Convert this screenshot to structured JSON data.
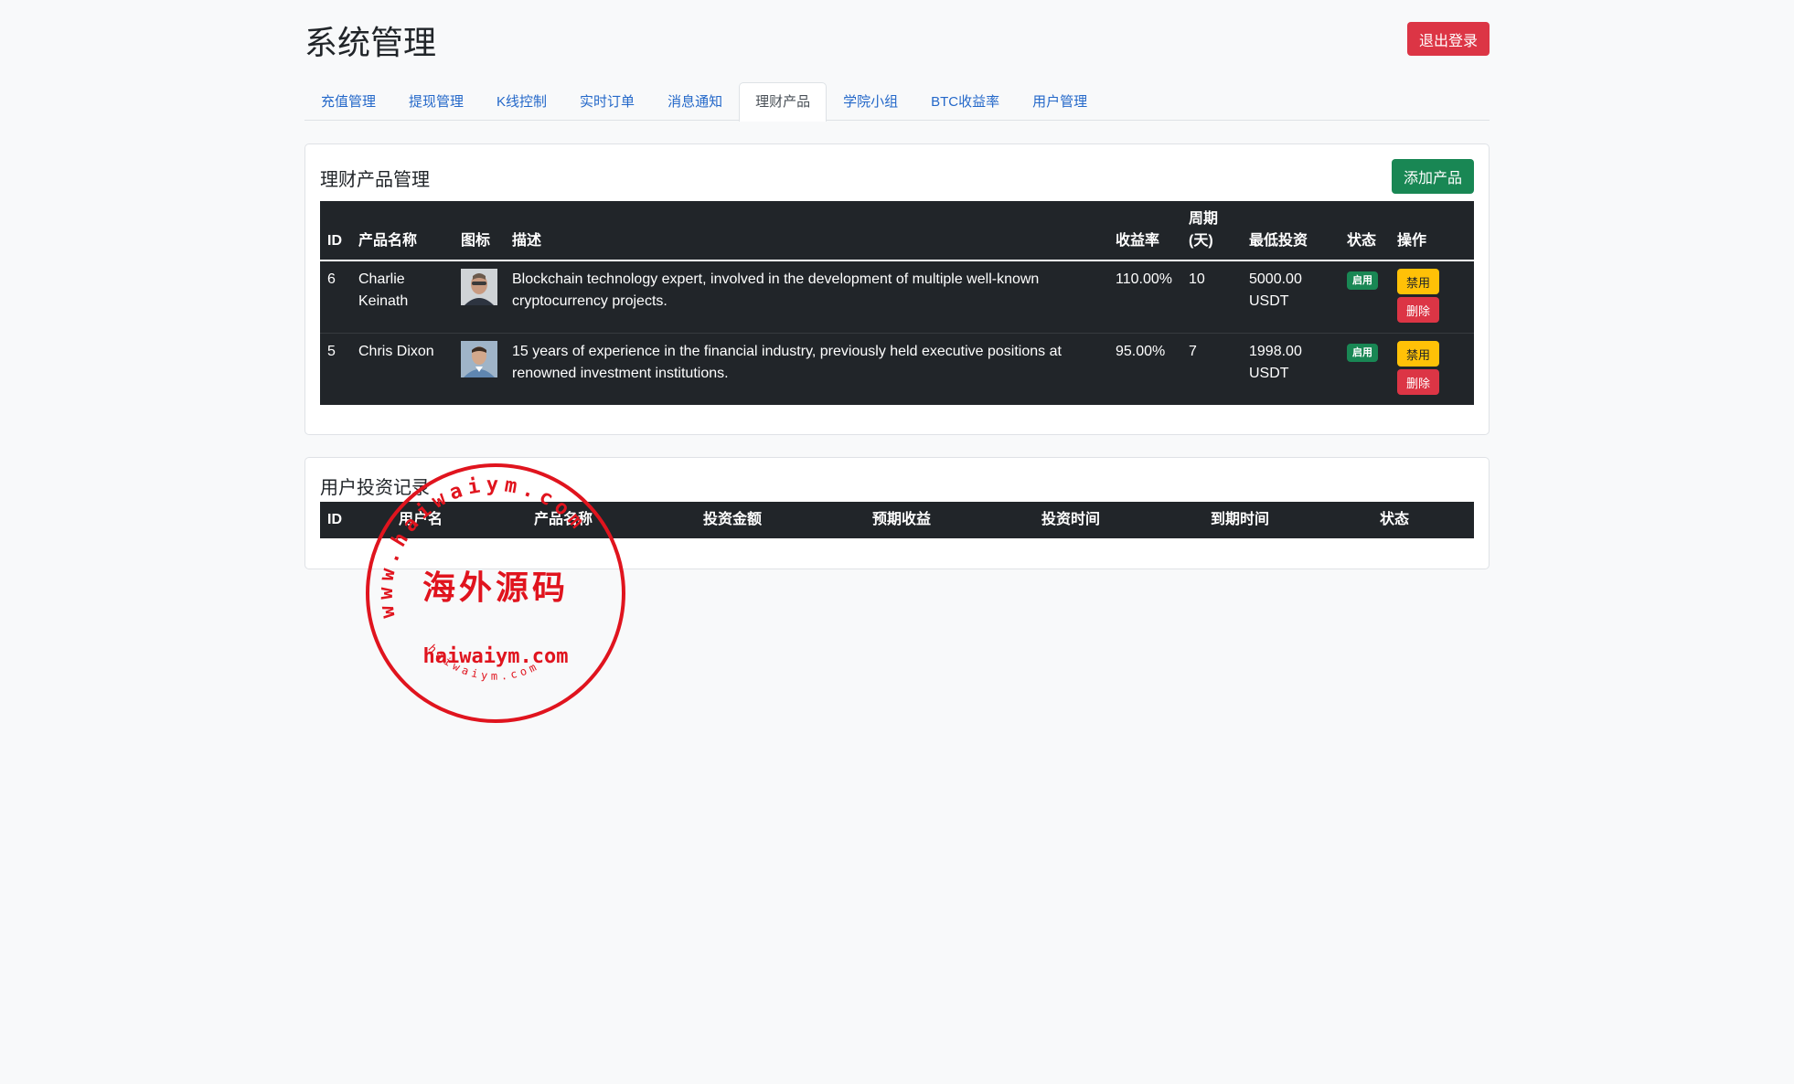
{
  "header": {
    "title": "系统管理",
    "logout_label": "退出登录"
  },
  "tabs": [
    {
      "label": "充值管理"
    },
    {
      "label": "提现管理"
    },
    {
      "label": "K线控制"
    },
    {
      "label": "实时订单"
    },
    {
      "label": "消息通知"
    },
    {
      "label": "理财产品"
    },
    {
      "label": "学院小组"
    },
    {
      "label": "BTC收益率"
    },
    {
      "label": "用户管理"
    }
  ],
  "products_card": {
    "title": "理财产品管理",
    "add_label": "添加产品",
    "columns": [
      "ID",
      "产品名称",
      "图标",
      "描述",
      "收益率",
      "周期(天)",
      "最低投资",
      "状态",
      "操作"
    ],
    "rows": [
      {
        "id": "6",
        "name": "Charlie Keinath",
        "description": "Blockchain technology expert, involved in the development of multiple well-known cryptocurrency projects.",
        "rate": "110.00%",
        "period": "10",
        "min_invest": "5000.00 USDT",
        "status": "启用",
        "disable_label": "禁用",
        "delete_label": "删除"
      },
      {
        "id": "5",
        "name": "Chris Dixon",
        "description": "15 years of experience in the financial industry, previously held executive positions at renowned investment institutions.",
        "rate": "95.00%",
        "period": "7",
        "min_invest": "1998.00 USDT",
        "status": "启用",
        "disable_label": "禁用",
        "delete_label": "删除"
      }
    ]
  },
  "investments_card": {
    "title": "用户投资记录",
    "columns": [
      "ID",
      "用户名",
      "产品名称",
      "投资金额",
      "预期收益",
      "投资时间",
      "到期时间",
      "状态"
    ]
  },
  "watermark": {
    "text_center": "海外源码",
    "text_domain": "haiwaiym.com",
    "text_ring": "www.haiwaiym.com",
    "text_small": "haiwaiym.com",
    "color": "#e0141e"
  },
  "colors": {
    "danger": "#dc3545",
    "success": "#198754",
    "warning": "#ffc107",
    "dark": "#212529",
    "link": "#2468c9"
  }
}
